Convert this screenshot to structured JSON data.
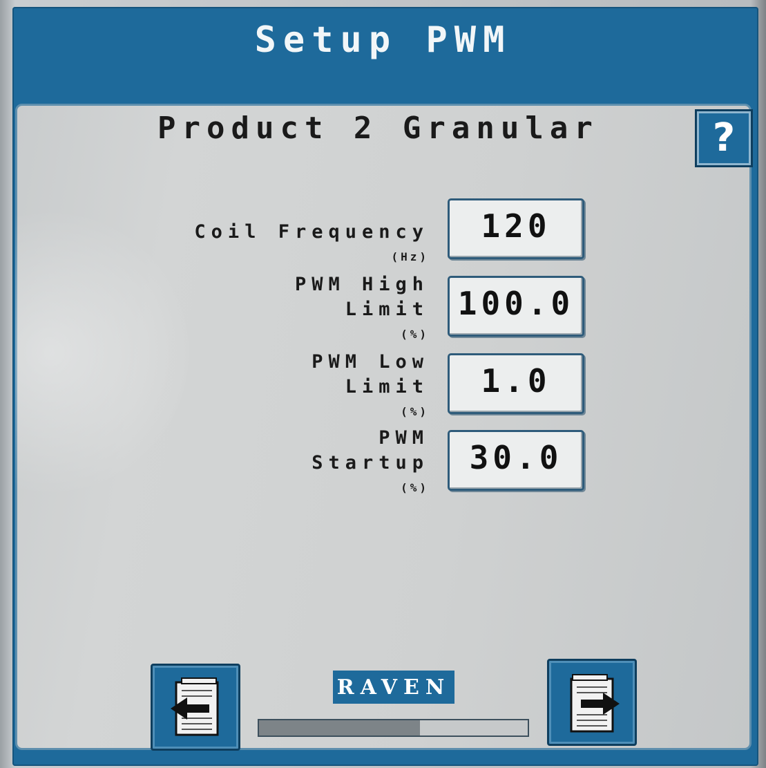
{
  "header": {
    "title": "Setup PWM"
  },
  "panel": {
    "product_title": "Product 2 Granular",
    "help_label": "?"
  },
  "fields": [
    {
      "label_lines": [
        "Coil Frequency"
      ],
      "unit": "(Hz)",
      "value": "120"
    },
    {
      "label_lines": [
        "PWM High",
        "Limit"
      ],
      "unit": "(%)",
      "value": "100.0"
    },
    {
      "label_lines": [
        "PWM Low",
        "Limit"
      ],
      "unit": "(%)",
      "value": "1.0"
    },
    {
      "label_lines": [
        "PWM",
        "Startup"
      ],
      "unit": "(%)",
      "value": "30.0"
    }
  ],
  "footer": {
    "brand": "RAVEN",
    "page_progress": 0.6,
    "back_icon": "page-back-icon",
    "next_icon": "page-forward-icon"
  },
  "colors": {
    "accent_blue": "#1e6a9b",
    "panel_gray": "#d0d2d2",
    "text_dark": "#1a1a1a"
  }
}
